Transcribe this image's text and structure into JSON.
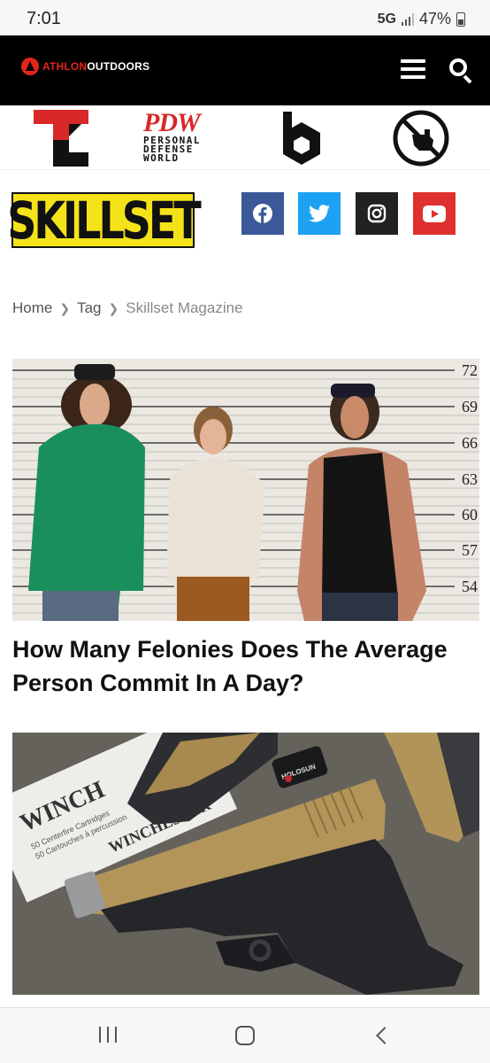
{
  "status_bar": {
    "time": "7:01",
    "network": "5G",
    "battery": "47%"
  },
  "header": {
    "logo_part1": "ATHLON",
    "logo_part2": "OUTDOORS",
    "menu_icon": "hamburger-menu-icon",
    "search_icon": "search-icon",
    "colors": {
      "background": "#000000",
      "brand_red": "#e3261b"
    }
  },
  "brands": {
    "pdw_title": "PDW",
    "pdw_subtitle": [
      "PERSONAL",
      "DEFENSE",
      "WORLD"
    ],
    "items": [
      "tl-logo",
      "pdw-logo",
      "b-hexagon-logo",
      "hand-pointing-logo"
    ]
  },
  "magazine": {
    "name": "SKILLSET",
    "colors": {
      "background": "#f5e31a"
    }
  },
  "social": {
    "items": [
      {
        "name": "facebook-icon",
        "color": "#3b5998"
      },
      {
        "name": "twitter-icon",
        "color": "#1da1f2"
      },
      {
        "name": "instagram-icon",
        "color": "#222222"
      },
      {
        "name": "youtube-icon",
        "color": "#e02f2f"
      }
    ]
  },
  "breadcrumb": {
    "home": "Home",
    "tag": "Tag",
    "current": "Skillset Magazine"
  },
  "articles": [
    {
      "title": "How Many Felonies Does The Average Person Commit In A Day?",
      "image_height_marks": [
        "72",
        "69",
        "66",
        "63",
        "60",
        "57",
        "54"
      ]
    },
    {
      "image_box_text": [
        "WINCH",
        "WINCHESTER",
        "50 Centerfire Cartridges",
        "50 Cartouches à percussion"
      ],
      "image_sight_text": "HOLOSUN"
    }
  ],
  "nav_bar": {
    "recent": "recent-apps-icon",
    "home": "home-icon",
    "back": "back-icon"
  }
}
